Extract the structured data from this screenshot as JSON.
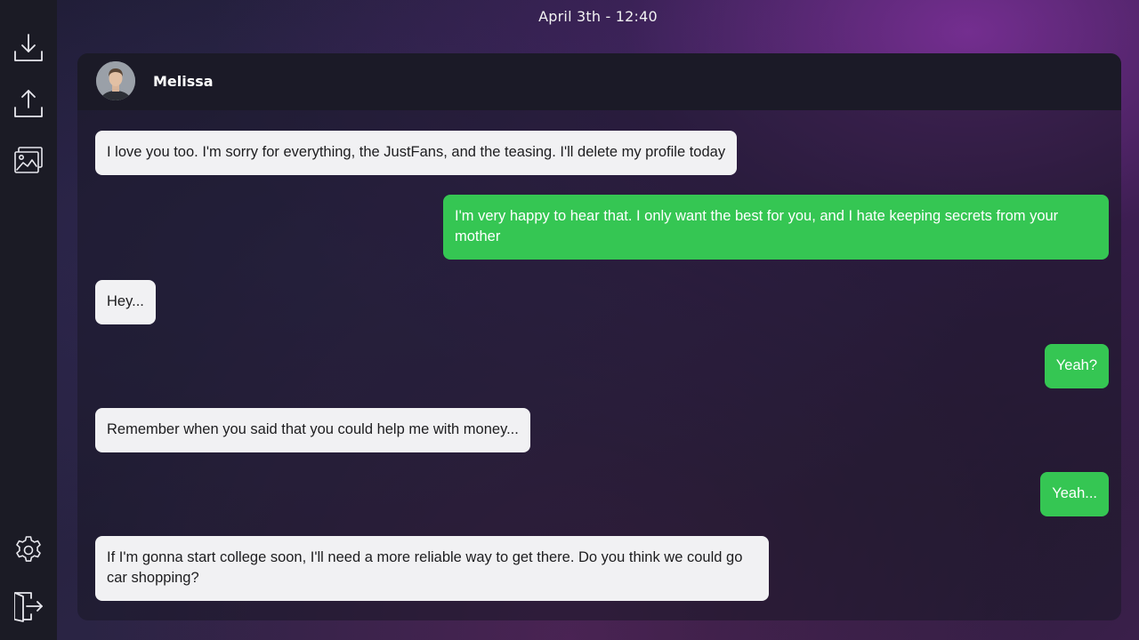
{
  "datetime": "April 3th - 12:40",
  "sidebar": {
    "items": [
      {
        "icon": "download-icon"
      },
      {
        "icon": "upload-icon"
      },
      {
        "icon": "gallery-icon"
      },
      {
        "icon": "settings-icon"
      },
      {
        "icon": "exit-icon"
      }
    ]
  },
  "contact": {
    "name": "Melissa",
    "avatar_icon": "avatar"
  },
  "messages": [
    {
      "from": "contact",
      "text": "I love you too. I'm sorry for everything, the JustFans, and the teasing. I'll delete my profile today"
    },
    {
      "from": "me",
      "text": "I'm very happy to hear that. I only want the best for you, and I hate keeping secrets from your mother"
    },
    {
      "from": "contact",
      "text": "Hey..."
    },
    {
      "from": "me",
      "text": "Yeah?"
    },
    {
      "from": "contact",
      "text": "Remember when you said that you could help me with money..."
    },
    {
      "from": "me",
      "text": "Yeah..."
    },
    {
      "from": "contact",
      "text": "If I'm gonna start college soon, I'll need a more reliable way to get there. Do you think we could go car shopping?"
    }
  ],
  "colors": {
    "incoming_bubble": "#f1f1f3",
    "outgoing_bubble": "#35c653",
    "sidebar": "#1b1b25",
    "header": "#1b1a27"
  }
}
